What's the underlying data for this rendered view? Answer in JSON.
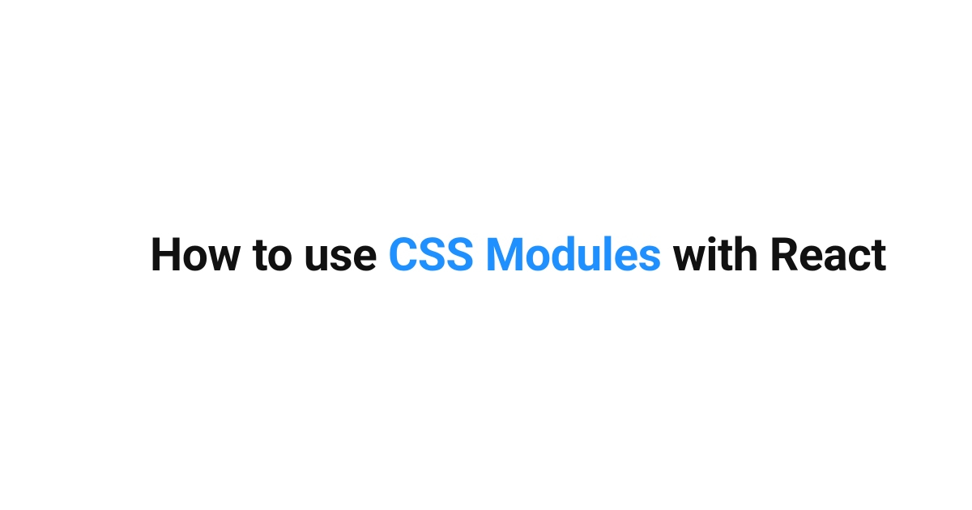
{
  "title": {
    "part1": "How to use ",
    "highlight": "CSS Modules",
    "part2": " with React"
  },
  "colors": {
    "accent": "#1e90ff",
    "text": "#111111"
  }
}
